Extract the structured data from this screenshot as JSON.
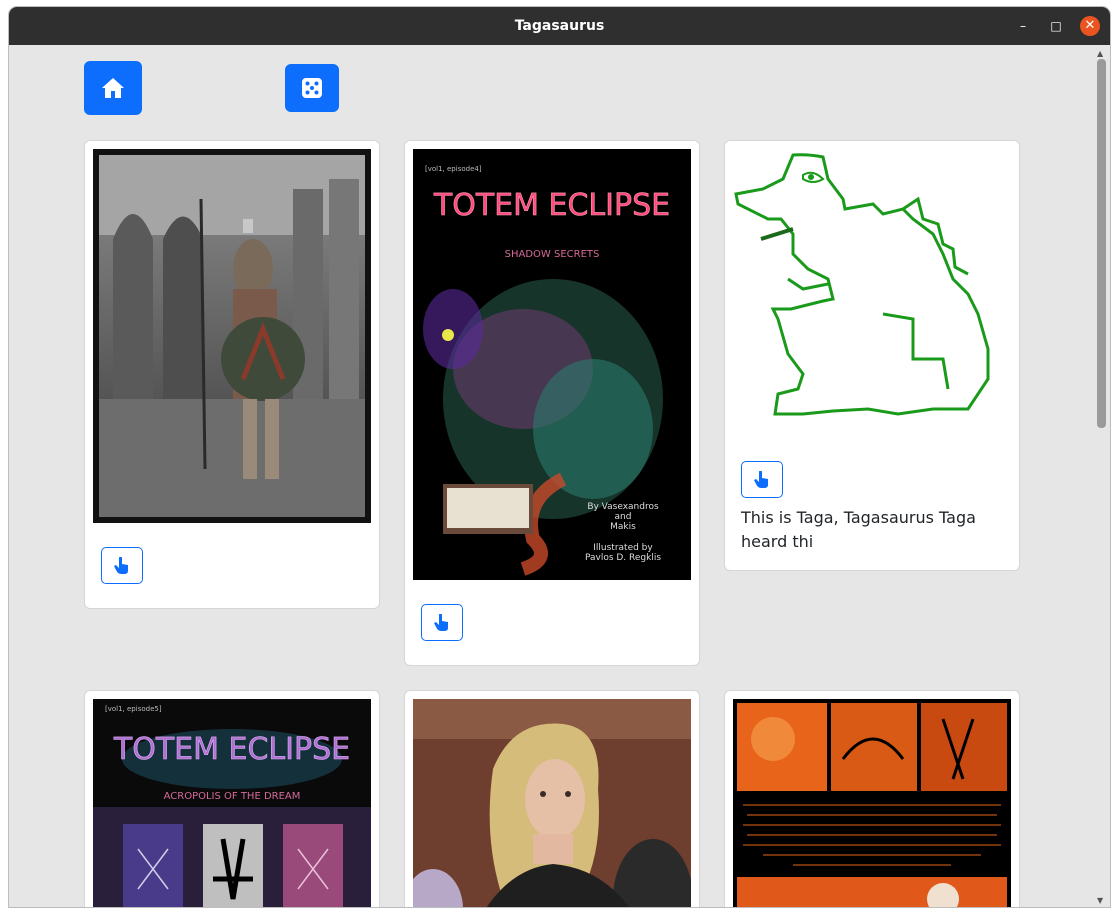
{
  "window": {
    "title": "Tagasaurus",
    "minimize_glyph": "–",
    "maximize_glyph": "□",
    "close_glyph": "✕"
  },
  "toolbar": {
    "home_icon": "home-icon",
    "random_icon": "dice-icon"
  },
  "cards": [
    {
      "image": "spartan-warrior-photo",
      "like_icon": "hand-pointer-icon",
      "caption": ""
    },
    {
      "image": "totem-eclipse-shadow-secrets-cover",
      "like_icon": "hand-pointer-icon",
      "caption": "",
      "cover": {
        "header": "[vol1, episode4]",
        "title": "TOTEM ECLIPSE",
        "subtitle": "SHADOW SECRETS",
        "credit_by": "By Vasexandros",
        "credit_and": "and",
        "credit_name": "Makis",
        "illustrated": "Illustrated by",
        "illustrator": "Pavlos D. Regklis"
      }
    },
    {
      "image": "taga-dinosaur-drawing",
      "like_icon": "hand-pointer-icon",
      "caption": "This is Taga, Tagasaurus Taga heard thi"
    },
    {
      "image": "totem-eclipse-acropolis-cover",
      "like_icon": "hand-pointer-icon",
      "caption": "",
      "cover": {
        "header": "[vol1, episode5]",
        "title": "TOTEM ECLIPSE",
        "subtitle": "ACROPOLIS OF THE DREAM"
      }
    },
    {
      "image": "woman-portrait-photo",
      "like_icon": "hand-pointer-icon",
      "caption": ""
    },
    {
      "image": "hercules-comic-page",
      "like_icon": "hand-pointer-icon",
      "caption": ""
    }
  ],
  "colors": {
    "accent": "#0d6efd",
    "background": "#e6e6e6",
    "titlebar": "#2f2f2f",
    "close": "#e95420",
    "drawing_stroke": "#1a9a1a"
  }
}
